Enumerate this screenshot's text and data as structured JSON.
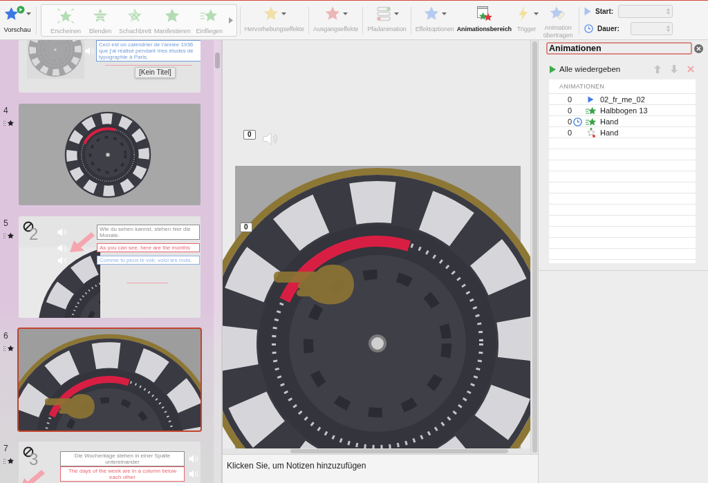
{
  "ribbon": {
    "preview": {
      "label": "Vorschau",
      "disabled": false
    },
    "gallery": {
      "effects": [
        {
          "label": "Erscheinen",
          "kind": "appear",
          "disabled": true
        },
        {
          "label": "Blenden",
          "kind": "fade",
          "disabled": true
        },
        {
          "label": "Schachbrett",
          "kind": "checker",
          "disabled": true
        },
        {
          "label": "Manifestieren",
          "kind": "materialize",
          "disabled": true
        },
        {
          "label": "Einfliegen",
          "kind": "fly",
          "disabled": true
        }
      ]
    },
    "groups": [
      {
        "tools": [
          {
            "label": "Hervorhebungseffekte",
            "kind": "emphasis",
            "disabled": true,
            "dropdown": true,
            "on": false
          }
        ]
      },
      {
        "tools": [
          {
            "label": "Ausgangseffekte",
            "kind": "exit",
            "disabled": true,
            "dropdown": true,
            "on": false
          }
        ]
      },
      {
        "tools": [
          {
            "label": "Pfadanimation",
            "kind": "path",
            "disabled": true,
            "dropdown": true,
            "on": false
          }
        ]
      },
      {
        "tools": [
          {
            "label": "Effektoptionen",
            "kind": "options",
            "disabled": true,
            "dropdown": true,
            "on": false
          },
          {
            "label": "Animationsbereich",
            "kind": "pane",
            "disabled": false,
            "dropdown": false,
            "on": true
          },
          {
            "label": "Trigger",
            "kind": "trigger",
            "disabled": true,
            "dropdown": true,
            "on": false
          },
          {
            "label": "Animation übertragen",
            "kind": "painter",
            "disabled": true,
            "dropdown": false,
            "on": false
          }
        ]
      }
    ],
    "timing": {
      "start": {
        "label": "Start:",
        "disabled": true
      },
      "duration": {
        "label": "Dauer:",
        "disabled": true
      }
    }
  },
  "slides": [
    {
      "kind": "intro",
      "selected": false,
      "texts": [
        {
          "text": "Ceci est un calendrier de l'année 1936 que j'ai réalisé pendant mes études de typographie à Paris.",
          "color": "#6f9ad8",
          "audio": true
        }
      ],
      "tooltip": "[Kein Titel]"
    },
    {
      "kind": "wheel",
      "number": "4",
      "animated": true,
      "selected": false
    },
    {
      "kind": "caption",
      "number": "5",
      "animated": true,
      "selected": false,
      "counter": "2",
      "texts": [
        {
          "text": "Wie du sehen kannst, stehen hier die Monate.",
          "color": "#8c8c8c",
          "audio": true
        },
        {
          "text": "As you can see, here are the months",
          "color": "#e86470",
          "audio": true
        },
        {
          "text": "Comme tu peux le voir, voici les mois.",
          "color": "#8fb2e6",
          "audio": true
        }
      ]
    },
    {
      "kind": "closeup",
      "number": "6",
      "animated": true,
      "selected": true
    },
    {
      "kind": "list",
      "number": "7",
      "animated": true,
      "selected": false,
      "counter": "3",
      "texts": [
        {
          "text": "Die Wochentage stehen in einer Spalte untereinander",
          "color": "#8c8c8c",
          "audio": true
        },
        {
          "text": "The days of the week are in a column below each other",
          "color": "#e86470",
          "audio": true
        }
      ]
    }
  ],
  "editor": {
    "audio_badge": "0",
    "slide_badge": "0"
  },
  "notes": {
    "placeholder": "Klicken Sie, um Notizen hinzuzufügen"
  },
  "animation_pane": {
    "title": "Animationen",
    "play_all": "Alle wiedergeben",
    "actions": [
      {
        "kind": "up",
        "disabled": true
      },
      {
        "kind": "down",
        "disabled": true
      },
      {
        "kind": "delete",
        "disabled": true
      }
    ],
    "list": {
      "header": "ANIMATIONEN",
      "items": [
        {
          "order": "0",
          "timed": false,
          "kind": "media",
          "name": "02_fr_me_02",
          "selected": false
        },
        {
          "order": "0",
          "timed": false,
          "kind": "entrance",
          "name": "Halbbogen 13",
          "selected": false
        },
        {
          "order": "0",
          "timed": true,
          "kind": "entrance",
          "name": "Hand",
          "selected": false
        },
        {
          "order": "0",
          "timed": false,
          "kind": "path",
          "name": "Hand",
          "selected": false
        }
      ]
    }
  }
}
